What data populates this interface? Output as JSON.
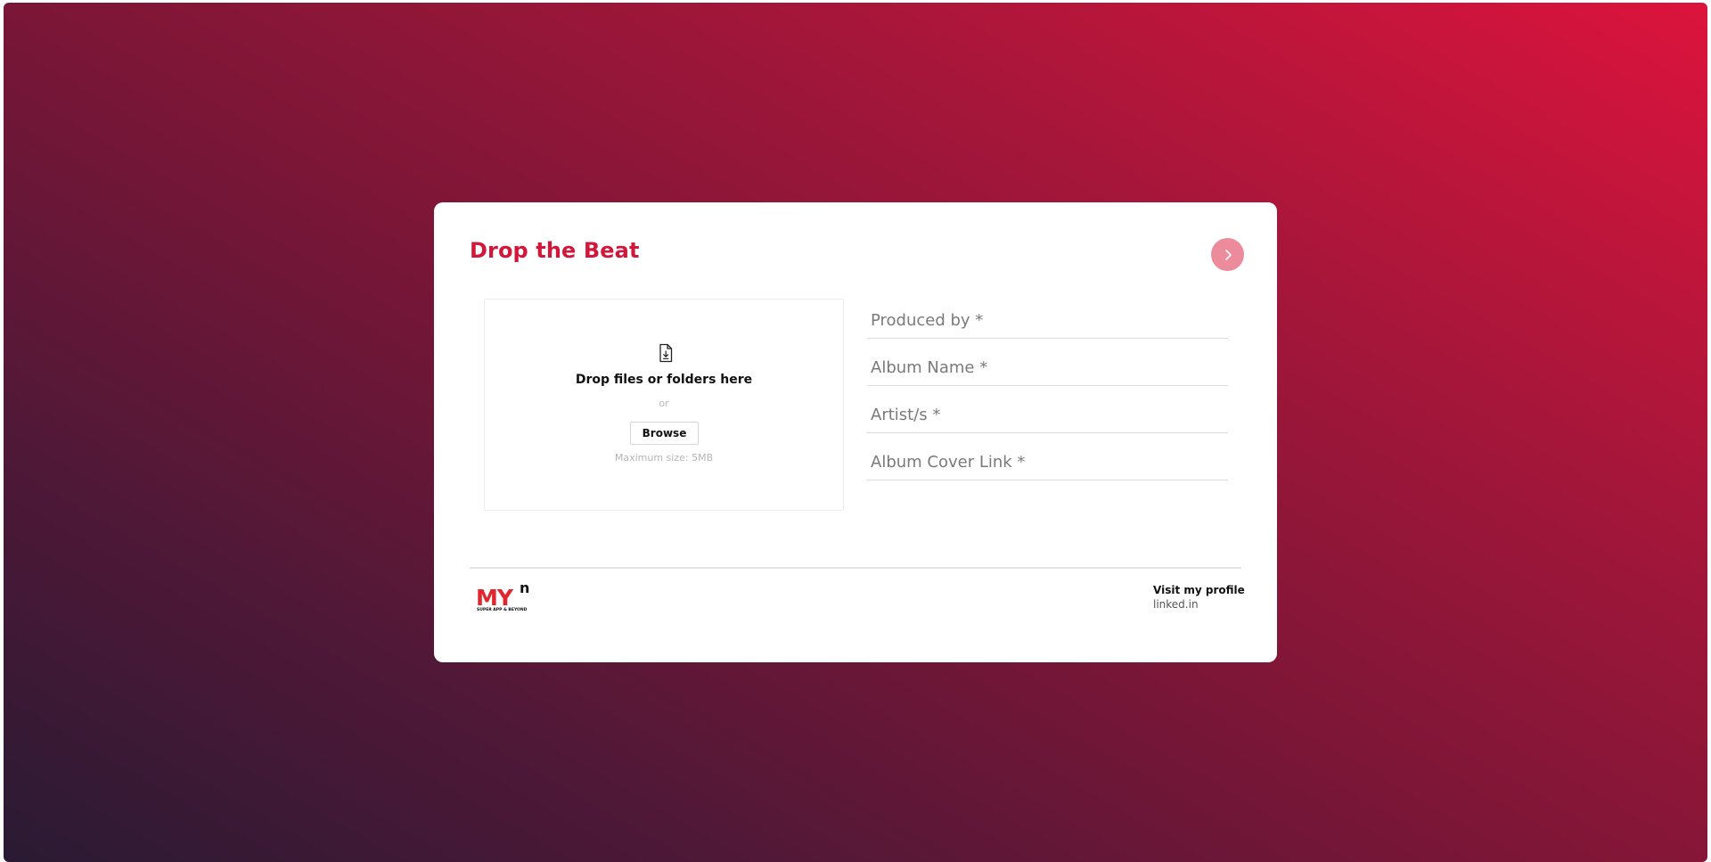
{
  "card": {
    "title": "Drop the Beat",
    "next_icon": "chevron-right-icon"
  },
  "upload": {
    "icon": "file-download-icon",
    "drop_text": "Drop files or folders here",
    "or_text": "or",
    "browse_label": "Browse",
    "max_size": "Maximum size: 5MB"
  },
  "form": {
    "produced_by_placeholder": "Produced by *",
    "album_name_placeholder": "Album Name *",
    "artists_placeholder": "Artist/s *",
    "album_cover_placeholder": "Album Cover Link *"
  },
  "footer": {
    "logo_text": "MY",
    "logo_superscript": "n",
    "logo_tagline": "SUPER APP & BEYOND",
    "profile_label": "Visit my profile",
    "profile_link": "linked.in"
  },
  "colors": {
    "accent": "#d3173b",
    "next_button": "#ec8b9b",
    "gradient_dark": "#2a1a33",
    "gradient_bright": "#dc143c"
  }
}
